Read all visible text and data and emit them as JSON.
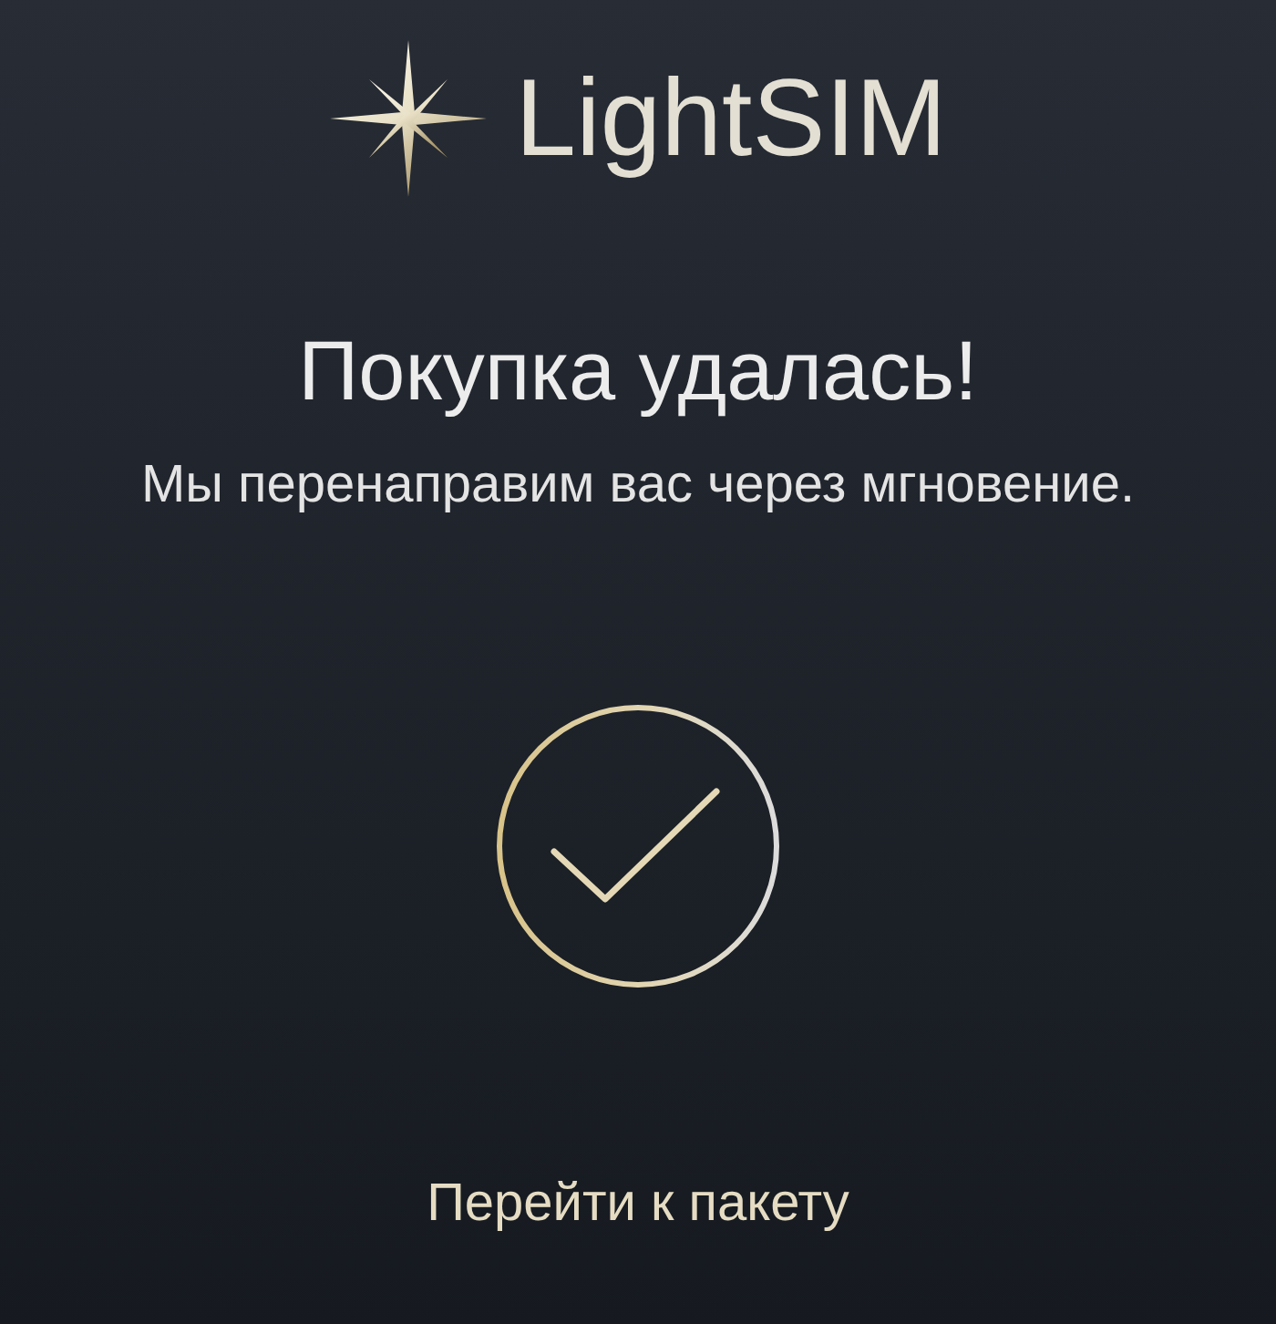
{
  "logo": {
    "text": "LightSIM"
  },
  "heading": "Покупка удалась!",
  "message": "Мы перенаправим вас через мгновение.",
  "link": {
    "label": "Перейти к пакету"
  }
}
